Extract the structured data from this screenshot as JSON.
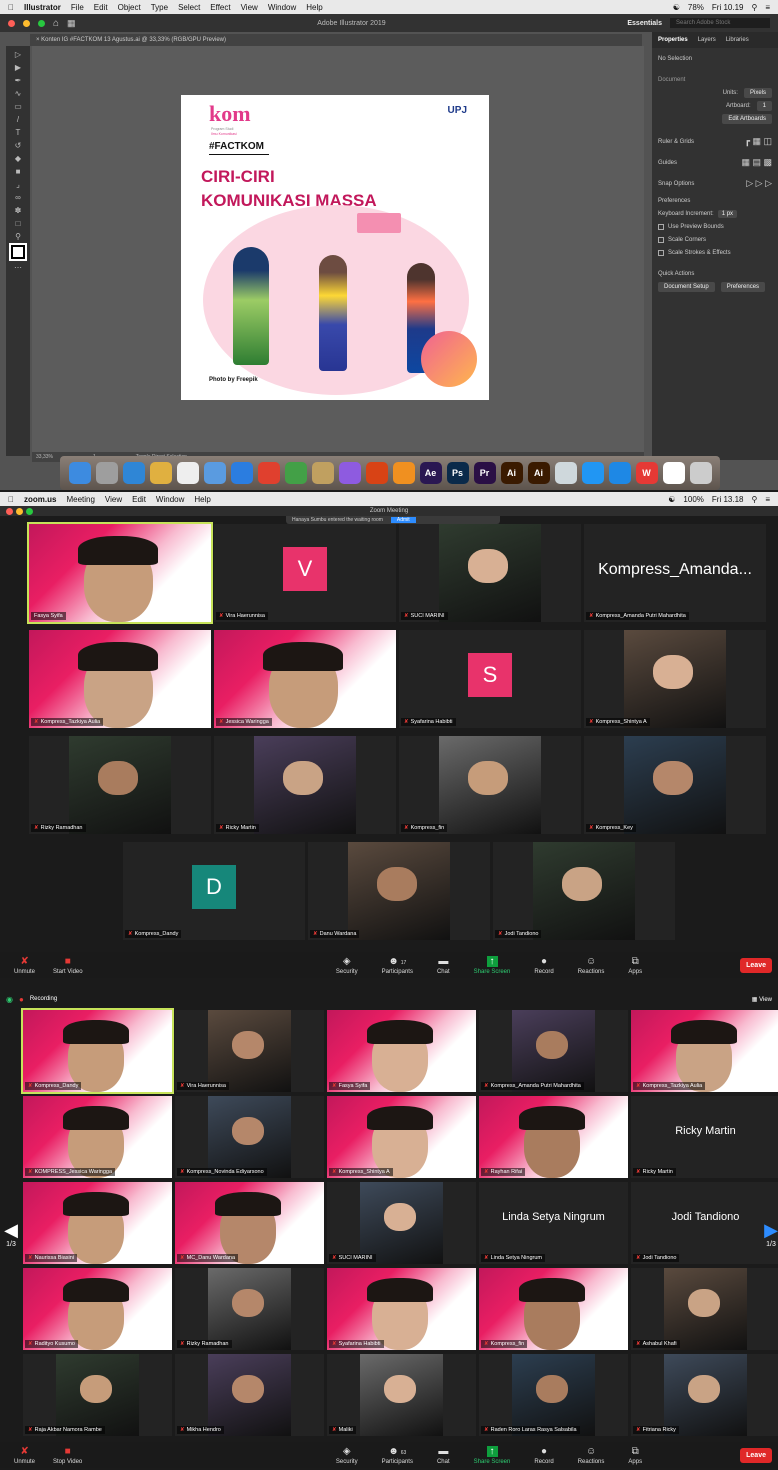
{
  "illustrator": {
    "menubar": {
      "app": "Illustrator",
      "items": [
        "File",
        "Edit",
        "Object",
        "Type",
        "Select",
        "Effect",
        "View",
        "Window",
        "Help"
      ],
      "battery": "78%",
      "clock": "Fri 10.19"
    },
    "title": "Adobe Illustrator 2019",
    "workspace": "Essentials",
    "search_placeholder": "Search Adobe Stock",
    "doc_tab": "Konten IG #FACTKOM 13 Agustus.ai @ 33,33% (RGB/GPU Preview)",
    "artboard": {
      "brand": "kom",
      "brand_sub1": "Program Studi",
      "brand_sub2": "Ilmu Komunikasi",
      "hashtag": "#FACTKOM",
      "line1": "CIRI-CIRI",
      "line2": "KOMUNIKASI MASSA",
      "logo": "UPJ",
      "credit": "Photo by Freepik"
    },
    "panel": {
      "tabs": [
        "Properties",
        "Layers",
        "Libraries"
      ],
      "selection": "No Selection",
      "document": "Document",
      "units_label": "Units:",
      "units_value": "Pixels",
      "artboard_label": "Artboard:",
      "artboard_value": "1",
      "edit_artboards": "Edit Artboards",
      "ruler": "Ruler & Grids",
      "guides": "Guides",
      "snap": "Snap Options",
      "preferences": "Preferences",
      "keyboard_inc_label": "Keyboard Increment:",
      "keyboard_inc_value": "1 px",
      "cb1": "Use Preview Bounds",
      "cb2": "Scale Corners",
      "cb3": "Scale Strokes & Effects",
      "quick": "Quick Actions",
      "doc_setup": "Document Setup",
      "prefs_btn": "Preferences"
    },
    "status": {
      "zoom": "33,33%",
      "page": "1",
      "tool": "Toggle Direct Selection"
    },
    "dock": [
      {
        "t": "",
        "c": "#3d8be0"
      },
      {
        "t": "",
        "c": "#9e9e9e"
      },
      {
        "t": "",
        "c": "#2f86d6"
      },
      {
        "t": "",
        "c": "#e0b040"
      },
      {
        "t": "",
        "c": "#eeeeee"
      },
      {
        "t": "",
        "c": "#5a9be0"
      },
      {
        "t": "",
        "c": "#2b7de0"
      },
      {
        "t": "",
        "c": "#e0402e"
      },
      {
        "t": "",
        "c": "#43a047"
      },
      {
        "t": "",
        "c": "#c0a060"
      },
      {
        "t": "",
        "c": "#8e5be0"
      },
      {
        "t": "",
        "c": "#d84315"
      },
      {
        "t": "",
        "c": "#f09020"
      },
      {
        "t": "Ae",
        "c": "#2a1752"
      },
      {
        "t": "Ps",
        "c": "#0a2a4a"
      },
      {
        "t": "Pr",
        "c": "#2a0f45"
      },
      {
        "t": "Ai",
        "c": "#3a1a00"
      },
      {
        "t": "Ai",
        "c": "#3a1a00"
      },
      {
        "t": "",
        "c": "#cfd8dc"
      },
      {
        "t": "",
        "c": "#2196f3"
      },
      {
        "t": "",
        "c": "#1e88e5"
      },
      {
        "t": "W",
        "c": "#e53935"
      },
      {
        "t": "",
        "c": "#ffffff"
      },
      {
        "t": "",
        "c": "#cccccc"
      }
    ]
  },
  "zoom1": {
    "menubar": {
      "app": "zoom.us",
      "items": [
        "Meeting",
        "View",
        "Edit",
        "Window",
        "Help"
      ],
      "battery": "100%",
      "clock": "Fri 13.18"
    },
    "title": "Zoom Meeting",
    "banner": "Hanaya Sumbu entered the waiting room",
    "admit": "Admit",
    "tiles": [
      {
        "name": "Fasya Syifa",
        "kind": "video",
        "muted": false,
        "active": true
      },
      {
        "name": "Vira Haerunnisa",
        "kind": "avatar",
        "letter": "V",
        "color": "#e8336b",
        "muted": true
      },
      {
        "name": "SUCI MARINI",
        "kind": "photo",
        "muted": true
      },
      {
        "name": "Kompress_Amanda Putri Mahardhita",
        "kind": "bigname",
        "big": "Kompress_Amanda...",
        "muted": true
      },
      {
        "name": "Kompress_Tazkiya Aulia",
        "kind": "video",
        "muted": true
      },
      {
        "name": "Jessica Waringga",
        "kind": "video",
        "muted": true
      },
      {
        "name": "Syafarina Habibti",
        "kind": "avatar",
        "letter": "S",
        "color": "#e8336b",
        "muted": true
      },
      {
        "name": "Kompress_Shintya A",
        "kind": "photo",
        "muted": true
      },
      {
        "name": "Rizky Ramadhan",
        "kind": "photo",
        "muted": true
      },
      {
        "name": "Ricky Martin",
        "kind": "photo",
        "muted": true
      },
      {
        "name": "Kompress_fin",
        "kind": "photo",
        "muted": true
      },
      {
        "name": "Kompress_Key",
        "kind": "photo",
        "muted": true
      },
      {
        "name": "Kompress_Dandy",
        "kind": "avatar",
        "letter": "D",
        "color": "#16877a",
        "muted": true
      },
      {
        "name": "Danu Wardana",
        "kind": "photo",
        "muted": true
      },
      {
        "name": "Jodi Tandiono",
        "kind": "photo",
        "muted": true
      }
    ],
    "controls": {
      "unmute": "Unmute",
      "video": "Start Video",
      "security": "Security",
      "participants": "Participants",
      "participants_count": "17",
      "chat": "Chat",
      "share": "Share Screen",
      "record": "Record",
      "reactions": "Reactions",
      "apps": "Apps",
      "leave": "Leave"
    }
  },
  "zoom2": {
    "recording": "Recording",
    "view": "View",
    "page_left": "1/3",
    "page_right": "1/3",
    "tiles": [
      {
        "name": "Kompress_Dandy",
        "kind": "video",
        "active": true
      },
      {
        "name": "Vira Haerunnisa",
        "kind": "photo"
      },
      {
        "name": "Fasya Syifa",
        "kind": "video"
      },
      {
        "name": "Kompress_Amanda Putri Mahardhita",
        "kind": "photo"
      },
      {
        "name": "Kompress_Tazkiya Aulia",
        "kind": "video"
      },
      {
        "name": "KOMPRESS_Jessica Waringga",
        "kind": "video"
      },
      {
        "name": "Kompress_Novinda Ediyarsono",
        "kind": "photo"
      },
      {
        "name": "Kompress_Shintya A",
        "kind": "video"
      },
      {
        "name": "Rayhan Rifai",
        "kind": "video"
      },
      {
        "name": "Ricky Martin",
        "kind": "bigname",
        "big": "Ricky Martin"
      },
      {
        "name": "Naurissa Biasini",
        "kind": "video"
      },
      {
        "name": "MC_Danu Wardana",
        "kind": "video"
      },
      {
        "name": "SUCI MARINI",
        "kind": "photo"
      },
      {
        "name": "Linda Setya Ningrum",
        "kind": "bigname",
        "big": "Linda Setya Ningrum"
      },
      {
        "name": "Jodi Tandiono",
        "kind": "bigname",
        "big": "Jodi Tandiono"
      },
      {
        "name": "Radityo Kusumo",
        "kind": "video"
      },
      {
        "name": "Rizky Ramadhan",
        "kind": "photo"
      },
      {
        "name": "Syafarina Habibti",
        "kind": "video"
      },
      {
        "name": "Kompress_fin",
        "kind": "video"
      },
      {
        "name": "Ashabul Khafi",
        "kind": "photo"
      },
      {
        "name": "Raja Akbar Namora Rambe",
        "kind": "photo"
      },
      {
        "name": "Mikha Hendro",
        "kind": "photo"
      },
      {
        "name": "Maliki",
        "kind": "photo"
      },
      {
        "name": "Raden Roro Laras Rasya Salsabila",
        "kind": "photo"
      },
      {
        "name": "Fitriana Ricky",
        "kind": "photo"
      }
    ],
    "controls": {
      "unmute": "Unmute",
      "video": "Stop Video",
      "security": "Security",
      "participants": "Participants",
      "participants_count": "63",
      "chat": "Chat",
      "share": "Share Screen",
      "record": "Record",
      "reactions": "Reactions",
      "apps": "Apps",
      "leave": "Leave"
    }
  }
}
